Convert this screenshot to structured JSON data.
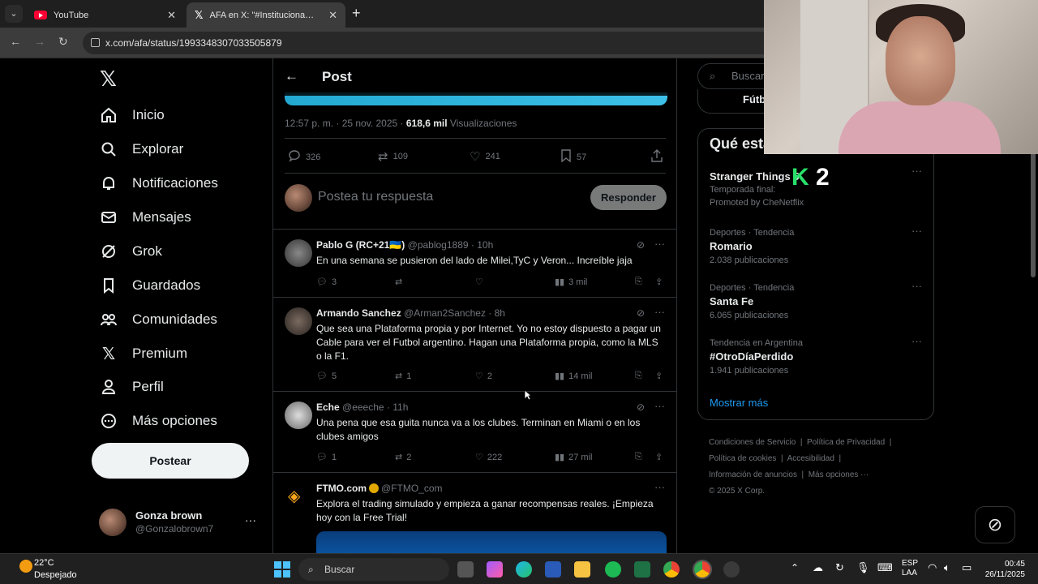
{
  "browser": {
    "tabs": [
      {
        "title": "YouTube",
        "icon": "youtube-icon"
      },
      {
        "title": "AFA en X: \"#Institucional Comu",
        "icon": "x-icon"
      }
    ],
    "url": "x.com/afa/status/1993348307033505879"
  },
  "leftnav": {
    "items": [
      {
        "label": "Inicio",
        "icon": "home-icon"
      },
      {
        "label": "Explorar",
        "icon": "search-icon"
      },
      {
        "label": "Notificaciones",
        "icon": "bell-icon"
      },
      {
        "label": "Mensajes",
        "icon": "envelope-icon"
      },
      {
        "label": "Grok",
        "icon": "grok-icon"
      },
      {
        "label": "Guardados",
        "icon": "bookmark-icon"
      },
      {
        "label": "Comunidades",
        "icon": "people-icon"
      },
      {
        "label": "Premium",
        "icon": "x-icon"
      },
      {
        "label": "Perfil",
        "icon": "person-icon"
      },
      {
        "label": "Más opciones",
        "icon": "more-circle-icon"
      }
    ],
    "post_button": "Postear",
    "account": {
      "name": "Gonza brown",
      "handle": "@Gonzalobrown7"
    }
  },
  "main": {
    "header_title": "Post",
    "timestamp": "12:57 p. m. · 25 nov. 2025 · ",
    "views_count": "618,6 mil",
    "views_label": " Visualizaciones",
    "stats": {
      "replies": "326",
      "reposts": "109",
      "likes": "241",
      "bookmarks": "57"
    },
    "reply_placeholder": "Postea tu respuesta",
    "reply_button": "Responder",
    "replies": [
      {
        "name": "Pablo G (RC+21🇺🇦)",
        "handle": "@pablog1889",
        "time": "· 10h",
        "text": "En una semana se pusieron del lado de Milei,TyC y Veron... Increíble jaja",
        "replies": "3",
        "reposts": "",
        "likes": "",
        "views": "3 mil"
      },
      {
        "name": "Armando Sanchez",
        "handle": "@Arman2Sanchez",
        "time": "· 8h",
        "text": "Que sea una Plataforma propia y por Internet. Yo no estoy dispuesto a pagar un Cable para ver el Futbol argentino. Hagan una Plataforma propia, como la MLS o la F1.",
        "replies": "5",
        "reposts": "1",
        "likes": "2",
        "views": "14 mil"
      },
      {
        "name": "Eche",
        "handle": "@eeeche",
        "time": "· 11h",
        "text": "Una pena que esa guita nunca va a los clubes. Terminan en Miami o en los clubes amigos",
        "replies": "1",
        "reposts": "2",
        "likes": "222",
        "views": "27 mil"
      }
    ],
    "promo": {
      "name": "FTMO.com",
      "handle": "@FTMO_com",
      "text": "Explora el trading simulado y empieza a ganar recompensas reales. ¡Empieza hoy con la Free Trial!"
    }
  },
  "rightcol": {
    "search_placeholder": "Buscar",
    "chip_label": "Fútbo",
    "trends_title": "Qué esta",
    "trends": [
      {
        "ctx": "Temporada final:",
        "topic": "Stranger Things 5",
        "cnt": "Promoted by CheNetflix"
      },
      {
        "ctx": "Deportes · Tendencia",
        "topic": "Romario",
        "cnt": "2.038 publicaciones"
      },
      {
        "ctx": "Deportes · Tendencia",
        "topic": "Santa Fe",
        "cnt": "6.065 publicaciones"
      },
      {
        "ctx": "Tendencia en Argentina",
        "topic": "#OtroDíaPerdido",
        "cnt": "1.941 publicaciones"
      }
    ],
    "show_more": "Mostrar más",
    "footer": [
      "Condiciones de Servicio",
      "Política de Privacidad",
      "Política de cookies",
      "Accesibilidad",
      "Información de anuncios",
      "Más opciones ···",
      "© 2025 X Corp."
    ]
  },
  "overlay": {
    "k_label": "K",
    "number": "2"
  },
  "taskbar": {
    "temp": "22°C",
    "weather": "Despejado",
    "search": "Buscar",
    "lang_top": "ESP",
    "lang_bottom": "LAA",
    "time": "00:45",
    "date": "26/11/2025"
  }
}
